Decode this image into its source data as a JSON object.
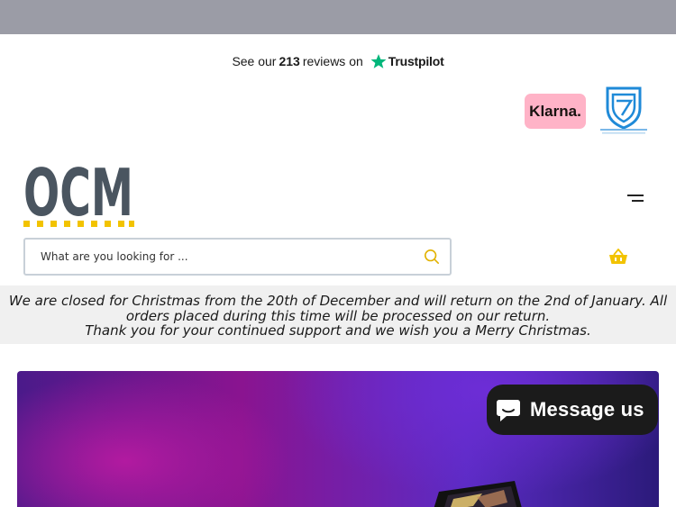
{
  "trustpilot": {
    "prefix": "See our",
    "count": "213",
    "suffix": "reviews on",
    "brand": "Trustpilot",
    "star_color": "#00b67a"
  },
  "badges": {
    "klarna": "Klarna.",
    "secure_icon": "securitymetrics-shield-icon"
  },
  "logo": {
    "text": "OCM",
    "text_color": "#4a5560",
    "dot_color": "#f2c300"
  },
  "search": {
    "placeholder": "What are you looking for ...",
    "icon": "search-icon",
    "icon_color": "#e2b200"
  },
  "header": {
    "menu_icon": "hamburger-icon",
    "cart_icon": "basket-icon",
    "cart_color": "#f2c300"
  },
  "notice": {
    "line1": "We are closed for Christmas from the 20th of December and will return on the 2nd of January. All",
    "line2": "orders placed during this time will be processed on our return.",
    "line3": "Thank you for your continued support and we wish you a Merry Christmas."
  },
  "chat": {
    "label": "Message us",
    "icon": "chat-bubble-icon"
  }
}
